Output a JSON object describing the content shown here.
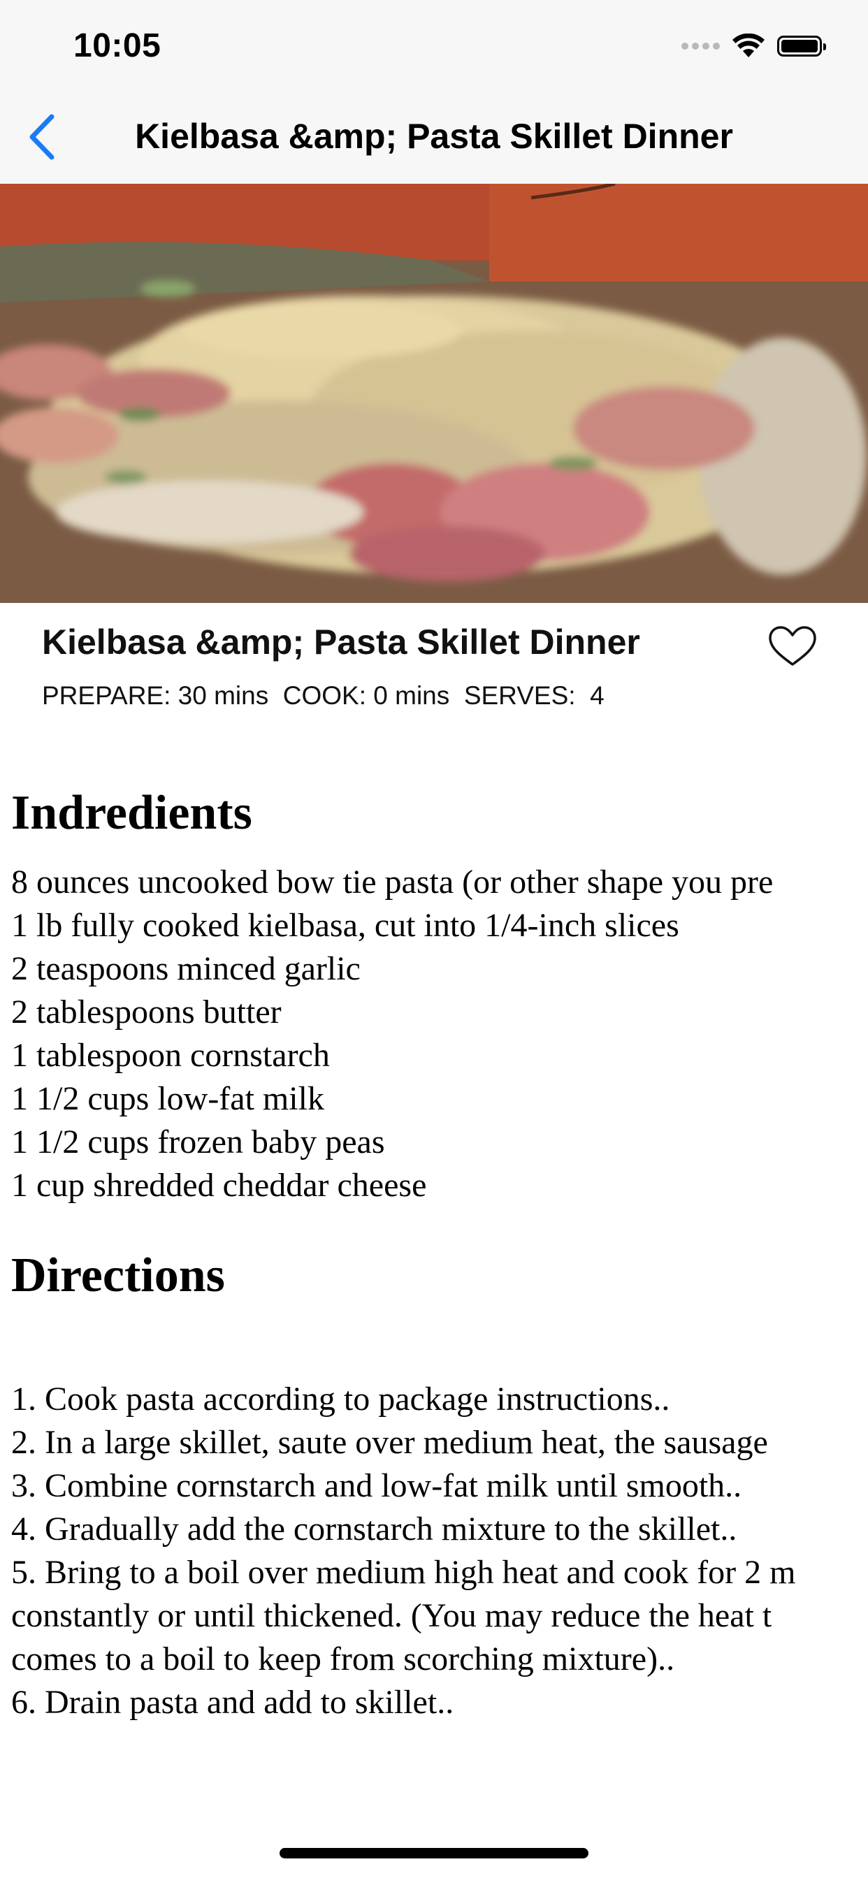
{
  "status_bar": {
    "time": "10:05"
  },
  "nav": {
    "title": "Kielbasa &amp; Pasta Skillet Dinner"
  },
  "hero_image": {
    "description": "food-photo",
    "accent_colors": [
      "#b9492e",
      "#d8c68f",
      "#c97a76",
      "#6f5640"
    ]
  },
  "recipe": {
    "title": "Kielbasa &amp; Pasta Skillet Dinner",
    "prepare_label": "PREPARE: 30 mins",
    "cook_label": "COOK: 0 mins",
    "serves_label": "SERVES:  4"
  },
  "ingredients": {
    "heading": "Indredients",
    "items": [
      "8 ounces uncooked bow tie pasta (or other shape you pre",
      "1 lb fully cooked kielbasa, cut into 1/4-inch slices",
      "2 teaspoons minced garlic",
      "2 tablespoons butter",
      "1 tablespoon cornstarch",
      "1 1/2 cups low-fat milk",
      "1 1/2 cups frozen baby peas",
      "1 cup shredded cheddar cheese"
    ]
  },
  "directions": {
    "heading": "Directions",
    "lines": [
      "1. Cook pasta according to package instructions..",
      "2. In a large skillet, saute over medium heat, the sausage",
      "3. Combine cornstarch and low-fat milk until smooth..",
      "4. Gradually add the cornstarch mixture to the skillet..",
      "5. Bring to a boil over medium high heat and cook for 2 m",
      "constantly or until thickened. (You may reduce the heat t",
      "comes to a boil to keep from scorching mixture)..",
      "6. Drain pasta and add to skillet.."
    ]
  },
  "colors": {
    "accent_blue": "#1a7cf5",
    "chrome_bg": "#f7f7f7"
  }
}
